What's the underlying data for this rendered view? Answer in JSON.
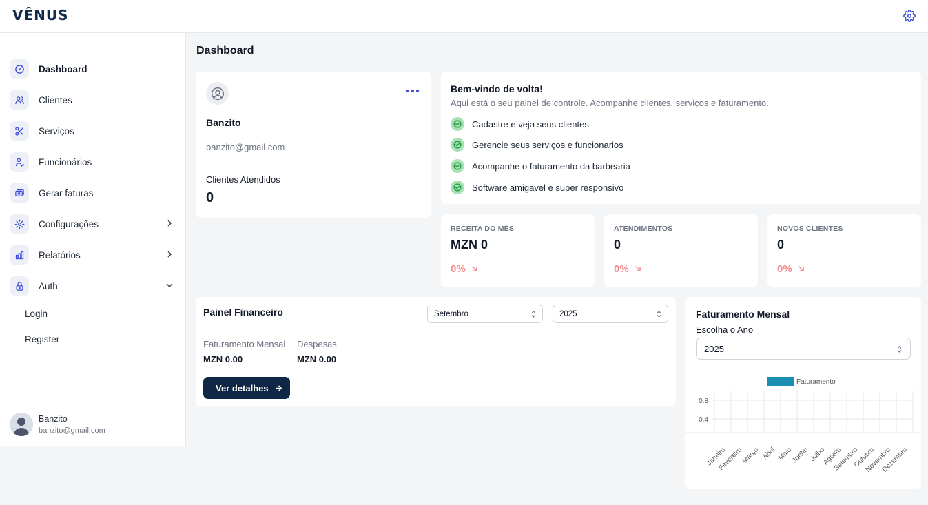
{
  "app": {
    "logo": "VÊNUS"
  },
  "sidebar": {
    "items": [
      {
        "label": "Dashboard",
        "icon": "gauge-icon",
        "active": true
      },
      {
        "label": "Clientes",
        "icon": "users-icon"
      },
      {
        "label": "Serviços",
        "icon": "scissors-icon"
      },
      {
        "label": "Funcionários",
        "icon": "employee-icon"
      },
      {
        "label": "Gerar faturas",
        "icon": "invoice-icon"
      },
      {
        "label": "Configurações",
        "icon": "gear-icon",
        "chevron": "right"
      },
      {
        "label": "Relatórios",
        "icon": "bar-chart-icon",
        "chevron": "right"
      },
      {
        "label": "Auth",
        "icon": "lock-icon",
        "chevron": "down"
      }
    ],
    "sub_items": [
      "Login",
      "Register"
    ],
    "user": {
      "name": "Banzito",
      "email": "banzito@gmail.com"
    }
  },
  "page": {
    "title": "Dashboard"
  },
  "profile": {
    "name": "Banzito",
    "email": "banzito@gmail.com",
    "clients_label": "Clientes Atendidos",
    "clients_value": "0"
  },
  "welcome": {
    "title": "Bem-vindo de volta!",
    "subtitle": "Aqui está o seu painel de controle. Acompanhe clientes, serviços e faturamento.",
    "features": [
      "Cadastre e veja seus clientes",
      "Gerencie seus serviços e funcionarios",
      "Acompanhe o faturamento da barbearia",
      "Software amigavel e super responsivo"
    ]
  },
  "stats": [
    {
      "label": "RECEITA DO MÊS",
      "value": "MZN 0",
      "change": "0%"
    },
    {
      "label": "ATENDIMENTOS",
      "value": "0",
      "change": "0%"
    },
    {
      "label": "NOVOS CLIENTES",
      "value": "0",
      "change": "0%"
    }
  ],
  "financial": {
    "title": "Painel Financeiro",
    "month_select": "Setembro",
    "year_select": "2025",
    "revenue_label": "Faturamento Mensal",
    "revenue_value": "MZN 0.00",
    "expenses_label": "Despesas",
    "expenses_value": "MZN 0.00",
    "button_label": "Ver detalhes"
  },
  "monthly": {
    "title": "Faturamento Mensal",
    "subtitle": "Escolha o Ano",
    "year": "2025"
  },
  "colors": {
    "accent": "#3b4bd8",
    "primary_button": "#0f2744",
    "chart_bar": "#1a8fb0",
    "check_bg": "#a7e3b4",
    "negative": "#f48c8c"
  },
  "chart_data": {
    "type": "bar",
    "categories": [
      "Janeiro",
      "Fevereiro",
      "Março",
      "Abril",
      "Maio",
      "Junho",
      "Julho",
      "Agosto",
      "Setembro",
      "Outubro",
      "Novembro",
      "Dezembro"
    ],
    "series": [
      {
        "name": "Faturamento",
        "values": [
          0,
          0,
          0,
          0,
          0,
          0,
          0,
          0,
          0,
          0,
          0,
          0
        ]
      }
    ],
    "yticks": [
      "0.8",
      "0.4"
    ],
    "legend": "top",
    "grid": true
  }
}
